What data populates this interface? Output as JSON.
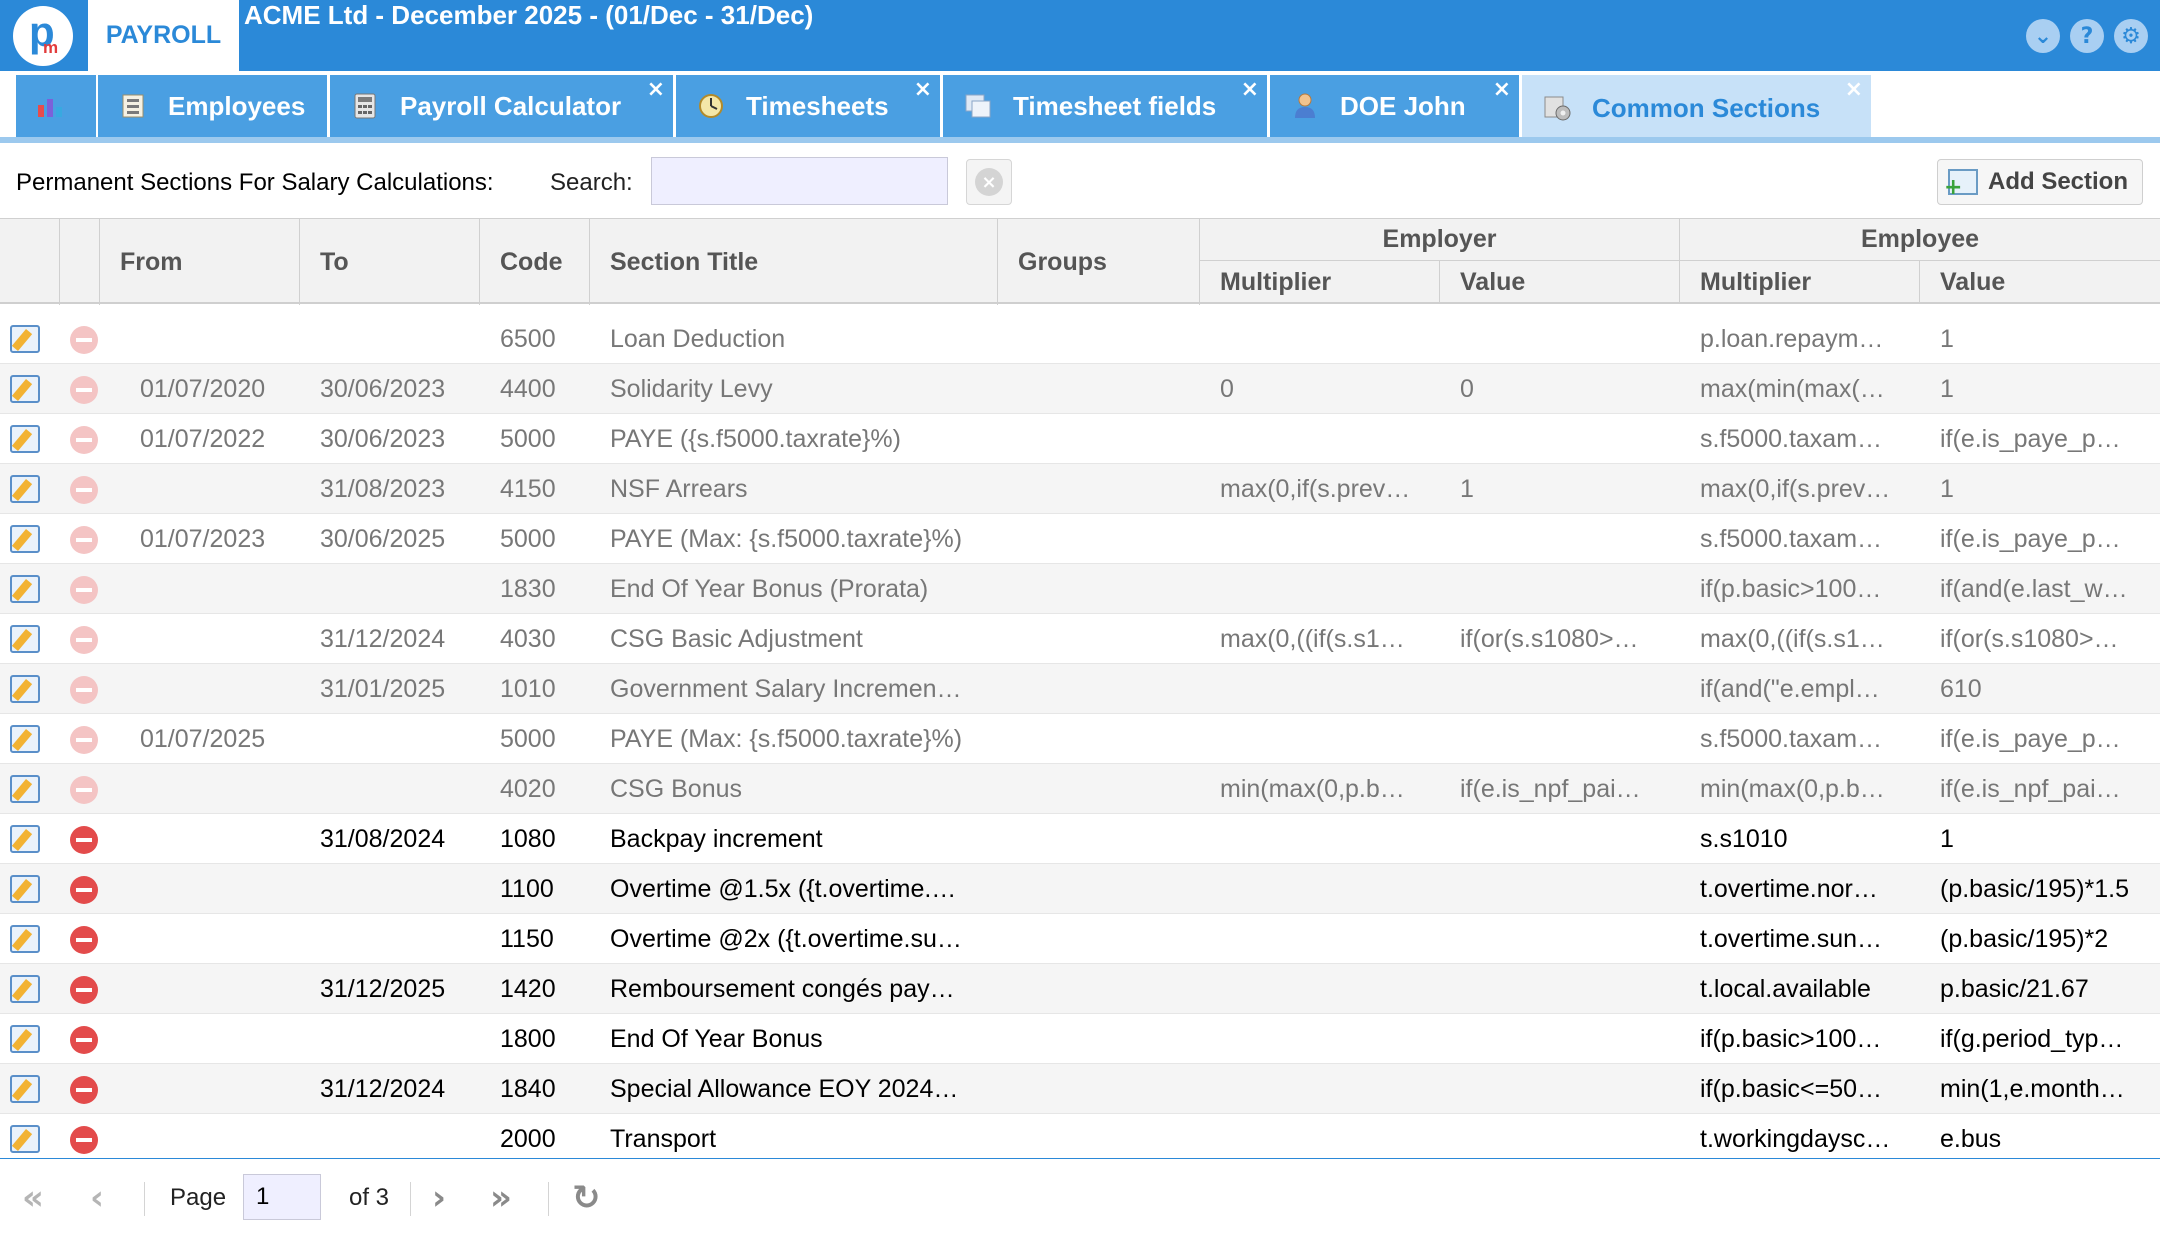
{
  "app": {
    "logo_letters": "pm",
    "module_tab": "PAYROLL",
    "title": "ACME Ltd - December 2025 - (01/Dec - 31/Dec)"
  },
  "titlebar_icons": [
    "chevron-down-icon",
    "help-icon",
    "gear-icon"
  ],
  "tabs": [
    {
      "label": "",
      "icon": "chart-icon"
    },
    {
      "label": "Employees",
      "icon": "employees-icon"
    },
    {
      "label": "Payroll Calculator",
      "icon": "calculator-icon",
      "closable": true
    },
    {
      "label": "Timesheets",
      "icon": "timesheets-icon",
      "closable": true
    },
    {
      "label": "Timesheet fields",
      "icon": "fields-icon",
      "closable": true
    },
    {
      "label": "DOE John",
      "icon": "person-icon",
      "closable": true
    },
    {
      "label": "Common Sections",
      "icon": "sections-icon",
      "closable": true,
      "active": true
    }
  ],
  "toolbar": {
    "heading": "Permanent Sections For Salary Calculations:",
    "search_label": "Search:",
    "search_value": "",
    "add_section": "Add Section"
  },
  "grid": {
    "headers": {
      "from": "From",
      "to": "To",
      "code": "Code",
      "title": "Section Title",
      "groups": "Groups",
      "employer": "Employer",
      "employee": "Employee",
      "multiplier": "Multiplier",
      "value": "Value"
    },
    "rows": [
      {
        "from": "",
        "to": "",
        "code": "6500",
        "title": "Loan Deduction",
        "groups": "",
        "er_mult": "",
        "er_val": "",
        "ee_mult": "p.loan.repaym…",
        "ee_val": "1",
        "active": false
      },
      {
        "from": "01/07/2020",
        "to": "30/06/2023",
        "code": "4400",
        "title": "Solidarity Levy",
        "groups": "",
        "er_mult": "0",
        "er_val": "0",
        "ee_mult": "max(min(max(…",
        "ee_val": "1",
        "active": false
      },
      {
        "from": "01/07/2022",
        "to": "30/06/2023",
        "code": "5000",
        "title": "PAYE ({s.f5000.taxrate}%)",
        "groups": "",
        "er_mult": "",
        "er_val": "",
        "ee_mult": "s.f5000.taxam…",
        "ee_val": "if(e.is_paye_p…",
        "active": false
      },
      {
        "from": "",
        "to": "31/08/2023",
        "code": "4150",
        "title": "NSF Arrears",
        "groups": "",
        "er_mult": "max(0,if(s.prev…",
        "er_val": "1",
        "ee_mult": "max(0,if(s.prev…",
        "ee_val": "1",
        "active": false
      },
      {
        "from": "01/07/2023",
        "to": "30/06/2025",
        "code": "5000",
        "title": "PAYE (Max: {s.f5000.taxrate}%)",
        "groups": "",
        "er_mult": "",
        "er_val": "",
        "ee_mult": "s.f5000.taxam…",
        "ee_val": "if(e.is_paye_p…",
        "active": false
      },
      {
        "from": "",
        "to": "",
        "code": "1830",
        "title": "End Of Year Bonus (Prorata)",
        "groups": "",
        "er_mult": "",
        "er_val": "",
        "ee_mult": "if(p.basic>100…",
        "ee_val": "if(and(e.last_w…",
        "active": false
      },
      {
        "from": "",
        "to": "31/12/2024",
        "code": "4030",
        "title": "CSG Basic Adjustment",
        "groups": "",
        "er_mult": "max(0,((if(s.s1…",
        "er_val": "if(or(s.s1080>…",
        "ee_mult": "max(0,((if(s.s1…",
        "ee_val": "if(or(s.s1080>…",
        "active": false
      },
      {
        "from": "",
        "to": "31/01/2025",
        "code": "1010",
        "title": "Government Salary Incremen…",
        "groups": "",
        "er_mult": "",
        "er_val": "",
        "ee_mult": "if(and(\"e.empl…",
        "ee_val": "610",
        "active": false
      },
      {
        "from": "01/07/2025",
        "to": "",
        "code": "5000",
        "title": "PAYE (Max: {s.f5000.taxrate}%)",
        "groups": "",
        "er_mult": "",
        "er_val": "",
        "ee_mult": "s.f5000.taxam…",
        "ee_val": "if(e.is_paye_p…",
        "active": false
      },
      {
        "from": "",
        "to": "",
        "code": "4020",
        "title": "CSG Bonus",
        "groups": "",
        "er_mult": "min(max(0,p.b…",
        "er_val": "if(e.is_npf_pai…",
        "ee_mult": "min(max(0,p.b…",
        "ee_val": "if(e.is_npf_pai…",
        "active": false
      },
      {
        "from": "",
        "to": "31/08/2024",
        "code": "1080",
        "title": "Backpay increment",
        "groups": "",
        "er_mult": "",
        "er_val": "",
        "ee_mult": "s.s1010",
        "ee_val": "1",
        "active": true
      },
      {
        "from": "",
        "to": "",
        "code": "1100",
        "title": "Overtime @1.5x ({t.overtime.…",
        "groups": "",
        "er_mult": "",
        "er_val": "",
        "ee_mult": "t.overtime.nor…",
        "ee_val": "(p.basic/195)*1.5",
        "active": true
      },
      {
        "from": "",
        "to": "",
        "code": "1150",
        "title": "Overtime @2x ({t.overtime.su…",
        "groups": "",
        "er_mult": "",
        "er_val": "",
        "ee_mult": "t.overtime.sun…",
        "ee_val": "(p.basic/195)*2",
        "active": true
      },
      {
        "from": "",
        "to": "31/12/2025",
        "code": "1420",
        "title": "Remboursement congés pay…",
        "groups": "",
        "er_mult": "",
        "er_val": "",
        "ee_mult": "t.local.available",
        "ee_val": "p.basic/21.67",
        "active": true
      },
      {
        "from": "",
        "to": "",
        "code": "1800",
        "title": "End Of Year Bonus",
        "groups": "",
        "er_mult": "",
        "er_val": "",
        "ee_mult": "if(p.basic>100…",
        "ee_val": "if(g.period_typ…",
        "active": true
      },
      {
        "from": "",
        "to": "31/12/2024",
        "code": "1840",
        "title": "Special Allowance EOY 2024…",
        "groups": "",
        "er_mult": "",
        "er_val": "",
        "ee_mult": "if(p.basic<=50…",
        "ee_val": "min(1,e.month…",
        "active": true
      },
      {
        "from": "",
        "to": "",
        "code": "2000",
        "title": "Transport",
        "groups": "",
        "er_mult": "",
        "er_val": "",
        "ee_mult": "t.workingdaysc…",
        "ee_val": "e.bus",
        "active": true
      }
    ]
  },
  "pager": {
    "page_label": "Page",
    "page_value": "1",
    "of_label": "of 3"
  }
}
